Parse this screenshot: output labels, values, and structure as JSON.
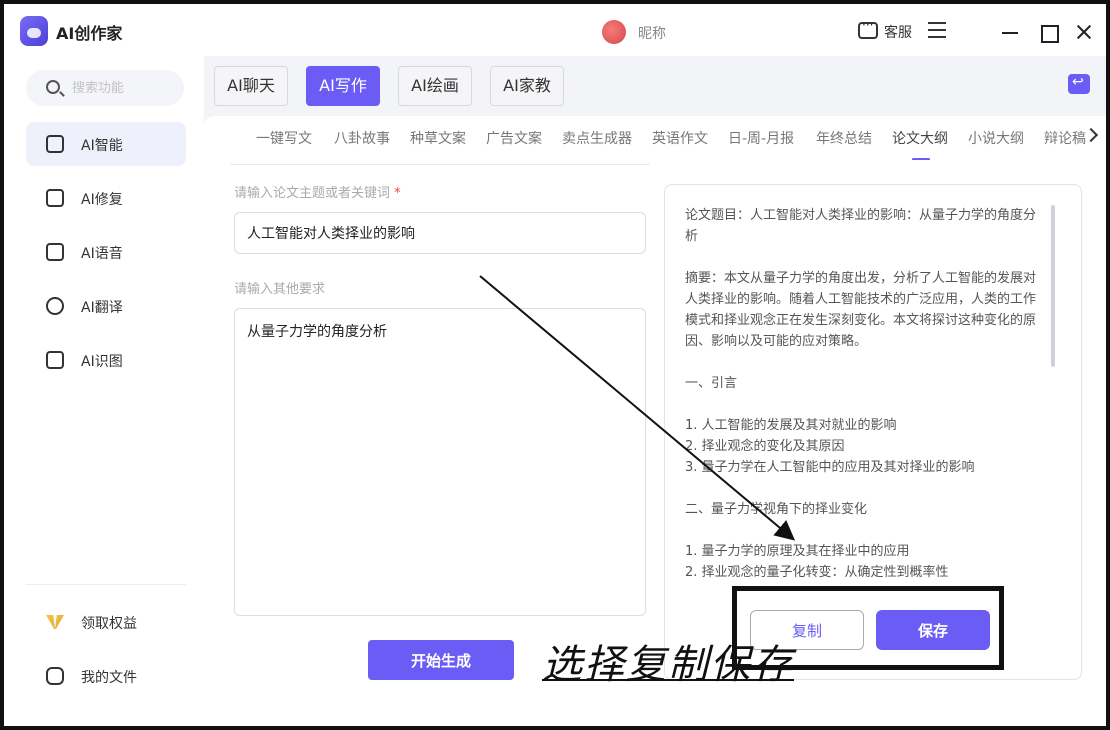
{
  "app": {
    "title": "AI创作家"
  },
  "header": {
    "nickname": "昵称",
    "service_label": "客服"
  },
  "sidebar": {
    "search_placeholder": "搜索功能",
    "items": [
      {
        "label": "AI智能",
        "icon": "ai-chip-icon",
        "active": true
      },
      {
        "label": "AI修复",
        "icon": "image-repair-icon"
      },
      {
        "label": "AI语音",
        "icon": "voice-icon"
      },
      {
        "label": "AI翻译",
        "icon": "translate-icon"
      },
      {
        "label": "AI识图",
        "icon": "image-recognize-icon"
      }
    ],
    "bottom_items": [
      {
        "label": "领取权益",
        "icon": "gift-icon"
      },
      {
        "label": "我的文件",
        "icon": "file-icon"
      }
    ]
  },
  "top_tabs": [
    {
      "label": "AI聊天"
    },
    {
      "label": "AI写作",
      "active": true
    },
    {
      "label": "AI绘画"
    },
    {
      "label": "AI家教"
    }
  ],
  "sub_tabs": [
    "一键写文",
    "八卦故事",
    "种草文案",
    "广告文案",
    "卖点生成器",
    "英语作文",
    "日-周-月报",
    "年终总结",
    "论文大纲",
    "小说大纲",
    "辩论稿"
  ],
  "sub_tab_active_index": 8,
  "form": {
    "topic_label": "请输入论文主题或者关键词",
    "required_mark": "*",
    "topic_value": "人工智能对人类择业的影响",
    "other_label": "请输入其他要求",
    "other_value": "从量子力学的角度分析",
    "generate_label": "开始生成"
  },
  "output": {
    "paragraphs": [
      "论文题目：人工智能对人类择业的影响：从量子力学的角度分析",
      "摘要：本文从量子力学的角度出发，分析了人工智能的发展对人类择业的影响。随着人工智能技术的广泛应用，人类的工作模式和择业观念正在发生深刻变化。本文将探讨这种变化的原因、影响以及可能的应对策略。",
      "一、引言",
      "1. 人工智能的发展及其对就业的影响",
      "2. 择业观念的变化及其原因",
      "3. 量子力学在人工智能中的应用及其对择业的影响",
      "二、量子力学视角下的择业变化",
      "1. 量子力学的原理及其在择业中的应用",
      "2. 择业观念的量子化转变：从确定性到概率性"
    ],
    "copy_label": "复制",
    "save_label": "保存"
  },
  "annotation": {
    "text": "选择复制保存"
  }
}
